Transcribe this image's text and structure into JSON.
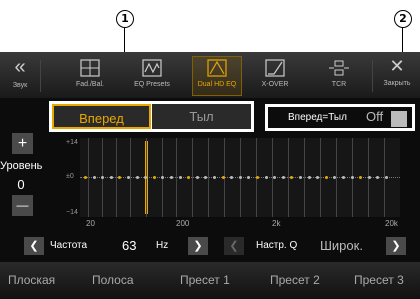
{
  "callouts": [
    "1",
    "2"
  ],
  "toolbar": {
    "back": "Звук",
    "items": [
      "Fad./Bal.",
      "EQ Presets",
      "Dual HD EQ",
      "X-OVER",
      "TCR"
    ],
    "close": "Закрыть"
  },
  "tabs": {
    "front": "Вперед",
    "rear": "Тыл"
  },
  "link": {
    "label": "Вперед=Тыл",
    "value": "Off"
  },
  "level": {
    "label": "Уровень",
    "value": "0",
    "plus": "+",
    "minus": "—"
  },
  "graph": {
    "y_labels": [
      "+14",
      "±0",
      "−14"
    ],
    "x_labels": [
      "20",
      "200",
      "2k",
      "20k"
    ],
    "selected_band_index": 0
  },
  "controls": {
    "freq_label": "Частота",
    "freq_value": "63",
    "freq_unit": "Hz",
    "q_label": "Настр. Q",
    "q_value": "Широк."
  },
  "presets": [
    "Плоская",
    "Полоса",
    "Пресет 1",
    "Пресет 2",
    "Пресет 3"
  ],
  "colors": {
    "accent": "#e8a800",
    "background": "#0c0c0c"
  }
}
